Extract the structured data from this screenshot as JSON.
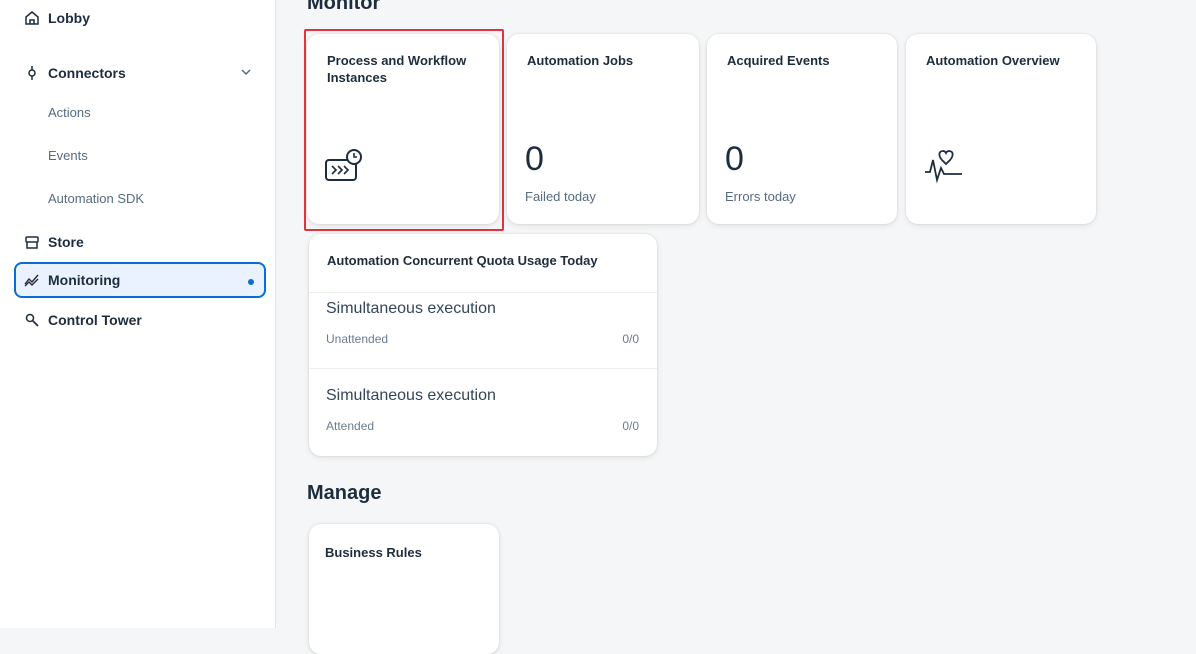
{
  "sidebar": {
    "items": [
      {
        "label": "Lobby",
        "icon": "home-icon"
      },
      {
        "label": "Connectors",
        "icon": "connectors-icon",
        "expanded": true,
        "children": [
          {
            "label": "Actions"
          },
          {
            "label": "Events"
          },
          {
            "label": "Automation SDK"
          }
        ]
      },
      {
        "label": "Store",
        "icon": "store-icon"
      },
      {
        "label": "Monitoring",
        "icon": "monitoring-icon",
        "active": true
      },
      {
        "label": "Control Tower",
        "icon": "control-tower-icon"
      }
    ]
  },
  "main": {
    "monitor_title": "Monitor",
    "manage_title": "Manage",
    "cards": [
      {
        "title": "Process and Workflow Instances",
        "icon": "process-instances-icon",
        "selected": true
      },
      {
        "title": "Automation Jobs",
        "value": "0",
        "subtitle": "Failed today"
      },
      {
        "title": "Acquired Events",
        "value": "0",
        "subtitle": "Errors today"
      },
      {
        "title": "Automation Overview",
        "icon": "heartbeat-icon"
      }
    ],
    "quota": {
      "title": "Automation Concurrent Quota Usage Today",
      "rows": [
        {
          "title": "Simultaneous execution",
          "label": "Unattended",
          "value": "0/0"
        },
        {
          "title": "Simultaneous execution",
          "label": "Attended",
          "value": "0/0"
        }
      ]
    },
    "manage_cards": [
      {
        "title": "Business Rules"
      }
    ]
  },
  "colors": {
    "accent": "#0a6ed1",
    "selection": "#e0323f",
    "active_bg": "#eaf1ff"
  }
}
